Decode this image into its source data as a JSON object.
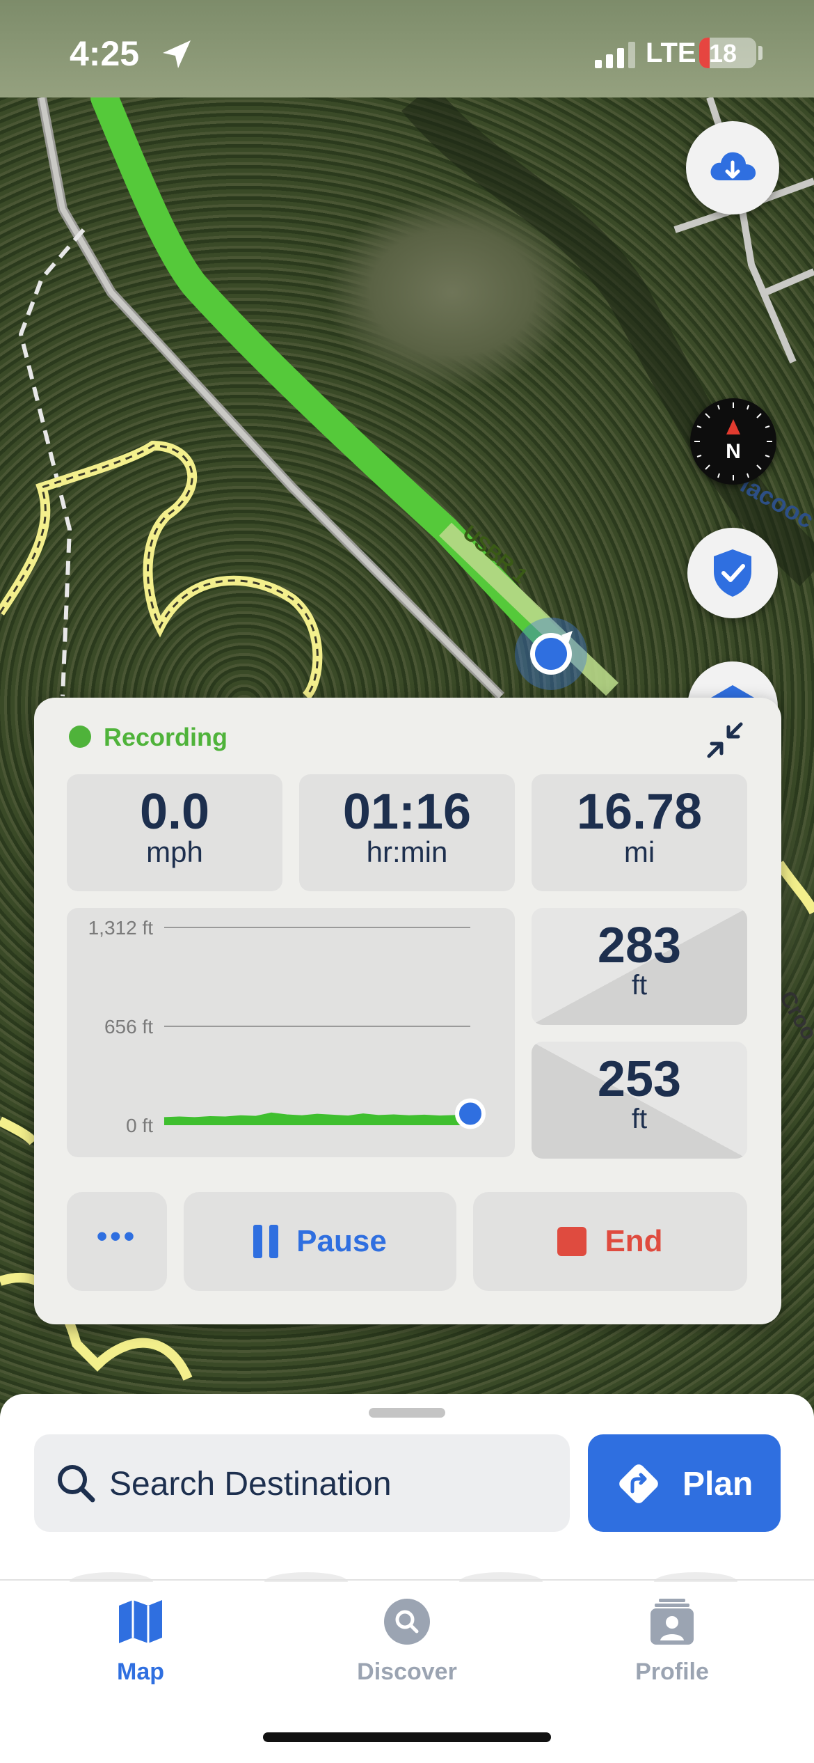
{
  "status_bar": {
    "time": "4:25",
    "network": "LTE",
    "battery": "18"
  },
  "map": {
    "road_label": "USBR 1",
    "river_label": "lacooc",
    "street_label": "Croo",
    "controls": {
      "download_icon": "cloud-download-icon",
      "compass_letter": "N",
      "shield_icon": "shield-check-icon",
      "layers_icon": "layers-icon"
    }
  },
  "recording": {
    "status": "Recording",
    "stats": [
      {
        "value": "0.0",
        "unit": "mph"
      },
      {
        "value": "01:16",
        "unit": "hr:min"
      },
      {
        "value": "16.78",
        "unit": "mi"
      }
    ],
    "elevation_gain": {
      "value": "283",
      "unit": "ft"
    },
    "elevation_loss": {
      "value": "253",
      "unit": "ft"
    },
    "actions": {
      "more": "•••",
      "pause": "Pause",
      "end": "End"
    }
  },
  "chart_data": {
    "type": "area",
    "ylabels": [
      "1,312 ft",
      "656 ft",
      "0 ft"
    ],
    "yticks": [
      1312,
      656,
      0
    ],
    "ylim": [
      0,
      1312
    ],
    "grid": true,
    "x": [
      0,
      0.05,
      0.1,
      0.15,
      0.2,
      0.25,
      0.3,
      0.35,
      0.4,
      0.45,
      0.5,
      0.55,
      0.6,
      0.65,
      0.7,
      0.75,
      0.8,
      0.85,
      0.9,
      0.95,
      1.0
    ],
    "values": [
      40,
      44,
      40,
      46,
      44,
      52,
      48,
      70,
      58,
      52,
      62,
      56,
      50,
      64,
      54,
      58,
      52,
      56,
      50,
      54,
      58
    ],
    "current_marker": true,
    "accent": "#3fbf2f"
  },
  "search": {
    "placeholder": "Search Destination",
    "plan_label": "Plan"
  },
  "tabs": [
    {
      "label": "Map",
      "icon": "map-icon",
      "active": true
    },
    {
      "label": "Discover",
      "icon": "discover-icon",
      "active": false
    },
    {
      "label": "Profile",
      "icon": "profile-icon",
      "active": false
    }
  ],
  "colors": {
    "accent": "#2f6fe0",
    "recording": "#4fb33a",
    "end": "#df4b3f",
    "text": "#1d2f4e"
  }
}
